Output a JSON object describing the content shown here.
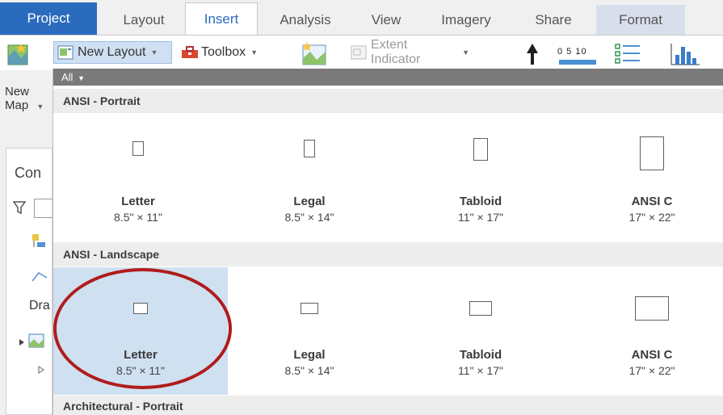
{
  "tabs": [
    "Project",
    "Layout",
    "Insert",
    "Analysis",
    "View",
    "Imagery",
    "Share",
    "Format"
  ],
  "ribbon": {
    "new_map": "New\nMap",
    "new_layout": "New Layout",
    "toolbox": "Toolbox",
    "extent_indicator": "Extent Indicator",
    "scale_numbers": "0 5 10"
  },
  "left_pane": {
    "title_partial": "Con",
    "draw_partial": "Dra"
  },
  "gallery": {
    "filter": "All",
    "sections": {
      "ansi_portrait": "ANSI - Portrait",
      "ansi_landscape": "ANSI - Landscape",
      "arch_portrait": "Architectural - Portrait"
    },
    "portrait": [
      {
        "name": "Letter",
        "size": "8.5\" × 11\""
      },
      {
        "name": "Legal",
        "size": "8.5\" × 14\""
      },
      {
        "name": "Tabloid",
        "size": "11\" × 17\""
      },
      {
        "name": "ANSI C",
        "size": "17\" × 22\""
      }
    ],
    "landscape": [
      {
        "name": "Letter",
        "size": "8.5\" × 11\"",
        "selected": true
      },
      {
        "name": "Legal",
        "size": "8.5\" × 14\""
      },
      {
        "name": "Tabloid",
        "size": "11\" × 17\""
      },
      {
        "name": "ANSI C",
        "size": "17\" × 22\""
      }
    ]
  },
  "colors": {
    "project_tab": "#2b6bbd",
    "selected_cell": "#cfe0f1",
    "highlight": "#b01c1c"
  }
}
